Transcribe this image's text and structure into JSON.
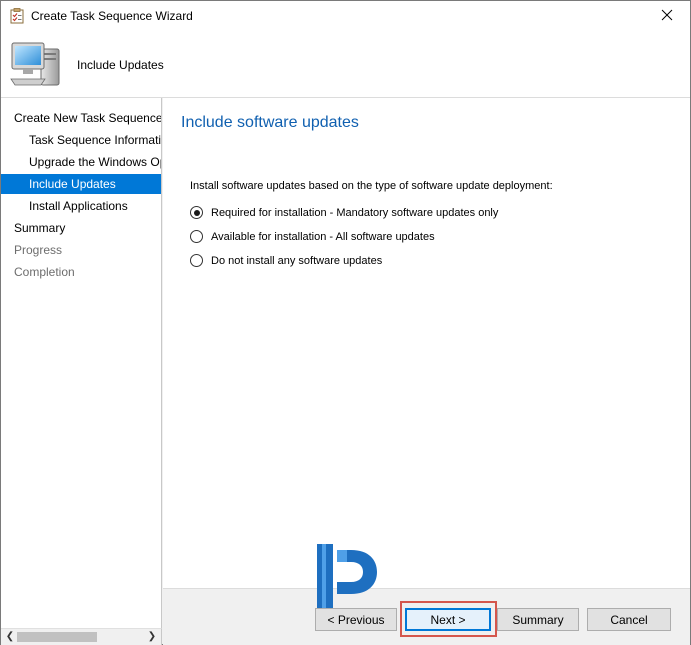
{
  "window": {
    "title": "Create Task Sequence Wizard",
    "close_icon": "close-icon"
  },
  "header": {
    "title": "Include Updates",
    "icon": "computer-icon"
  },
  "nav": {
    "items": [
      {
        "label": "Create New Task Sequence",
        "level": 0,
        "state": "normal"
      },
      {
        "label": "Task Sequence Information",
        "level": 1,
        "state": "normal"
      },
      {
        "label": "Upgrade the Windows Operating System",
        "level": 1,
        "state": "normal"
      },
      {
        "label": "Include Updates",
        "level": 1,
        "state": "selected"
      },
      {
        "label": "Install Applications",
        "level": 1,
        "state": "normal"
      },
      {
        "label": "Summary",
        "level": 0,
        "state": "normal"
      },
      {
        "label": "Progress",
        "level": 0,
        "state": "disabled"
      },
      {
        "label": "Completion",
        "level": 0,
        "state": "disabled"
      }
    ]
  },
  "content": {
    "heading": "Include software updates",
    "description": "Install software updates based on the type of software update deployment:",
    "options": [
      {
        "label": "Required for installation - Mandatory software updates only",
        "checked": true
      },
      {
        "label": "Available for installation - All software updates",
        "checked": false
      },
      {
        "label": "Do not install any software updates",
        "checked": false
      }
    ]
  },
  "buttons": {
    "previous": "< Previous",
    "next": "Next >",
    "summary": "Summary",
    "cancel": "Cancel"
  },
  "colors": {
    "selection": "#0078d7",
    "heading": "#1060b0",
    "highlight": "#d4574d",
    "logo_blue": "#1e6fc0"
  }
}
